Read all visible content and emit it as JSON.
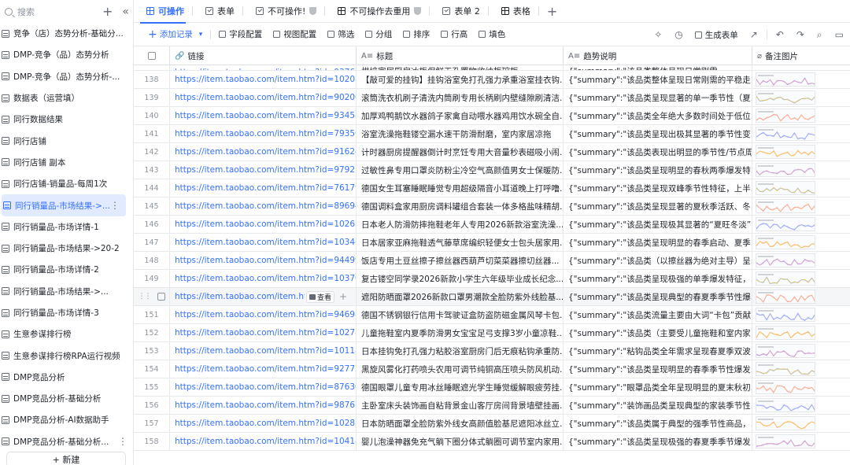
{
  "sidebar": {
    "search_placeholder": "搜索",
    "items": [
      {
        "label": "竞争（店）态势分析-基础分..."
      },
      {
        "label": "DMP-竞争（品）态势分析"
      },
      {
        "label": "DMP-竞争（品）态势分析-..."
      },
      {
        "label": "数据表（运营填）"
      },
      {
        "label": "同行数据结果"
      },
      {
        "label": "同行店铺"
      },
      {
        "label": "同行店铺 副本"
      },
      {
        "label": "同行店铺-销量品-每周1次"
      },
      {
        "label": "同行销量品-市场结果->...",
        "active": true
      },
      {
        "label": "同行销量品-市场详情-1"
      },
      {
        "label": "同行销量品-市场结果->20-2"
      },
      {
        "label": "同行销量品-市场详情-2"
      },
      {
        "label": "同行销量品-市场结果->..."
      },
      {
        "label": "同行销量品-市场详情-3"
      },
      {
        "label": "生意参谋排行榜"
      },
      {
        "label": "生意参谋排行榜RPA运行视频"
      },
      {
        "label": "DMP竞品分析"
      },
      {
        "label": "DMP竞品分析-基础分析"
      },
      {
        "label": "DMP竞品分析-AI数据助手"
      },
      {
        "label": "DMP竞品分析-基础分析..."
      }
    ],
    "new_label": "+ 新建"
  },
  "tabs": [
    {
      "label": "可操作",
      "active": true
    },
    {
      "label": "表单"
    },
    {
      "label": "不可操作!"
    },
    {
      "label": "不可操作去重用"
    },
    {
      "label": "表单 2"
    },
    {
      "label": "表格"
    }
  ],
  "toolbar": {
    "add_record": "添加记录",
    "field_config": "字段配置",
    "view_config": "视图配置",
    "filter": "筛选",
    "group": "分组",
    "sort": "排序",
    "row_height": "行高",
    "fill": "填色",
    "generate_form": "生成表单"
  },
  "columns": {
    "link": "链接",
    "title": "标题",
    "trend": "趋势说明",
    "image": "备注图片"
  },
  "view_button": "查看",
  "rows": [
    {
      "num": "138",
      "link": "https://item.taobao.com/item.htm?id=1020809...",
      "title": "【敲可爱的挂钩】挂钩浴室免打孔强力承重浴室挂衣钩...",
      "trend": "{\"summary\":\"该品类整体呈现日常刚需的平稳走..."
    },
    {
      "num": "139",
      "link": "https://item.taobao.com/item.htm?id=9020019...",
      "title": "滚筒洗衣机刷子清洗内筒刷专用长柄刷内壁缝隙刷清洁...",
      "trend": "{\"summary\":\"该品类呈现显著的单一季节性（夏..."
    },
    {
      "num": "140",
      "link": "https://item.taobao.com/item.htm?id=9345843...",
      "title": "加厚鸡鸭鹅饮水器鸽子家禽自动喂水器鸡用饮水碗全自...",
      "trend": "{\"summary\":\"该品类全年绝大多数时间处于低位..."
    },
    {
      "num": "141",
      "link": "https://item.taobao.com/item.htm?id=7935601...",
      "title": "浴室洗澡拖鞋镂空漏水速干防滑耐磨，室内家居凉拖",
      "trend": "{\"summary\":\"该品类呈现出极其显著的季节性变..."
    },
    {
      "num": "142",
      "link": "https://item.taobao.com/item.htm?id=9162425...",
      "title": "计时器厨房提醒器倒计时烹饪专用大音量秒表磁吸小闹...",
      "trend": "{\"summary\":\"该品类表现出明显的季节性/节点周..."
    },
    {
      "num": "143",
      "link": "https://item.taobao.com/item.htm?id=9792733...",
      "title": "过敏性鼻专用口罩炎防粉尘冷空气高颜值男女士保暖防...",
      "trend": "{\"summary\":\"该品类呈现明显的春秋两季爆发特..."
    },
    {
      "num": "144",
      "link": "https://item.taobao.com/item.htm?id=7617962...",
      "title": "德国女生耳塞睡眠睡觉专用超级隔音小耳道晚上打呼噜...",
      "trend": "{\"summary\":\"该品类呈现双峰季节性特征，上半..."
    },
    {
      "num": "145",
      "link": "https://item.taobao.com/item.htm?id=8969425...",
      "title": "德国调料盒家用厨房调料罐组合套装一体多格盐味精胡...",
      "trend": "{\"summary\":\"该品类呈现显著的夏秋季活跃、冬..."
    },
    {
      "num": "146",
      "link": "https://item.taobao.com/item.htm?id=1026189...",
      "title": "日本老人防滑防摔拖鞋老年人专用2026新款浴室洗澡...",
      "trend": "{\"summary\":\"该品类呈现极其显著的“夏旺冬淡”..."
    },
    {
      "num": "147",
      "link": "https://item.taobao.com/item.htm?id=1034653...",
      "title": "日本居家亚麻拖鞋透气藤草席编织轻便女士包头居家用...",
      "trend": "{\"summary\":\"该品类呈现明显的春季启动、夏季..."
    },
    {
      "num": "148",
      "link": "https://item.taobao.com/item.htm?id=9449960...",
      "title": "饭店专用土豆丝擦子擦丝器西葫芦切菜菜器擦切丝器...",
      "trend": "{\"summary\":\"该品类（以擦丝器为绝对主导）呈..."
    },
    {
      "num": "149",
      "link": "https://item.taobao.com/item.htm?id=1037018...",
      "title": "复古镂空同学录2026新款小学生六年级毕业成长纪念...",
      "trend": "{\"summary\":\"该品类呈现极强的单季爆发特征，..."
    },
    {
      "num": "150",
      "link": "https://item.taobao.com/item.htm?i",
      "title": "遮阳防晒面罩2026新款口罩男潮款全脸防紫外线脸基...",
      "trend": "{\"summary\":\"该品类呈现典型的春夏季季节性爆...",
      "hover": true
    },
    {
      "num": "151",
      "link": "https://item.taobao.com/item.htm?id=9469872...",
      "title": "德国不锈钢银行信用卡驾驶证盒防盗防磁金属风琴卡包...",
      "trend": "{\"summary\":\"该品类流量主要由大词“卡包”贡献..."
    },
    {
      "num": "152",
      "link": "https://item.taobao.com/item.htm?id=1027896...",
      "title": "儿童拖鞋室内夏季防滑男女宝宝足弓支撑3岁小童凉鞋...",
      "trend": "{\"summary\":\"该品类（主要受儿童拖鞋和室内家..."
    },
    {
      "num": "153",
      "link": "https://item.taobao.com/item.htm?id=10118211...",
      "title": "日本挂钩免打孔强力粘胶浴室厨房门后无痕粘钩承重防...",
      "trend": "{\"summary\":\"粘钩品类全年需求呈现春夏季双波..."
    },
    {
      "num": "154",
      "link": "https://item.taobao.com/item.htm?id=9277214...",
      "title": "黑旋风雾化打药喷头农用可调节纯铜高压喷头防风机动...",
      "trend": "{\"summary\":\"该品类呈现明显的春季季节性爆发..."
    },
    {
      "num": "155",
      "link": "https://item.taobao.com/item.htm?id=8763086...",
      "title": "德国眼罩儿童专用冰丝睡眠遮光学生睡觉缓解眼疲劳挂...",
      "trend": "{\"summary\":\"眼罩品类全年呈现明显的夏末秋初..."
    },
    {
      "num": "156",
      "link": "https://item.taobao.com/item.htm?id=9876733...",
      "title": "主卧室床头装饰画自粘背景金山客厅房间背景墙壁挂画...",
      "trend": "{\"summary\":\"装饰画品类呈现典型的家装季节性..."
    },
    {
      "num": "157",
      "link": "https://item.taobao.com/item.htm?id=1028502...",
      "title": "日本防晒面罩全脸防紫外线女高颜值脸基尼遮阳冰丝立...",
      "trend": "{\"summary\":\"该品类属于典型的强季节性商品，..."
    },
    {
      "num": "158",
      "link": "https://item.taobao.com/item.htm?id=1041890...",
      "title": "婴儿泡澡神器免充气躺下圈分体式躺圈可调节室内家用...",
      "trend": "{\"summary\":\"该品类呈现极强的春夏季季节爆发..."
    }
  ],
  "partial_top_row": {
    "link": "https://item.taobao.com/item.htm?id=9376247...",
    "title": "烘焙家居厨房冰柜保鲜无孔置物收纳柜碗柜...",
    "trend": "{\"summary\":\"该品类整体呈现日常刚需..."
  },
  "colors": {
    "accent": "#3370ff",
    "border": "#dee0e3"
  }
}
